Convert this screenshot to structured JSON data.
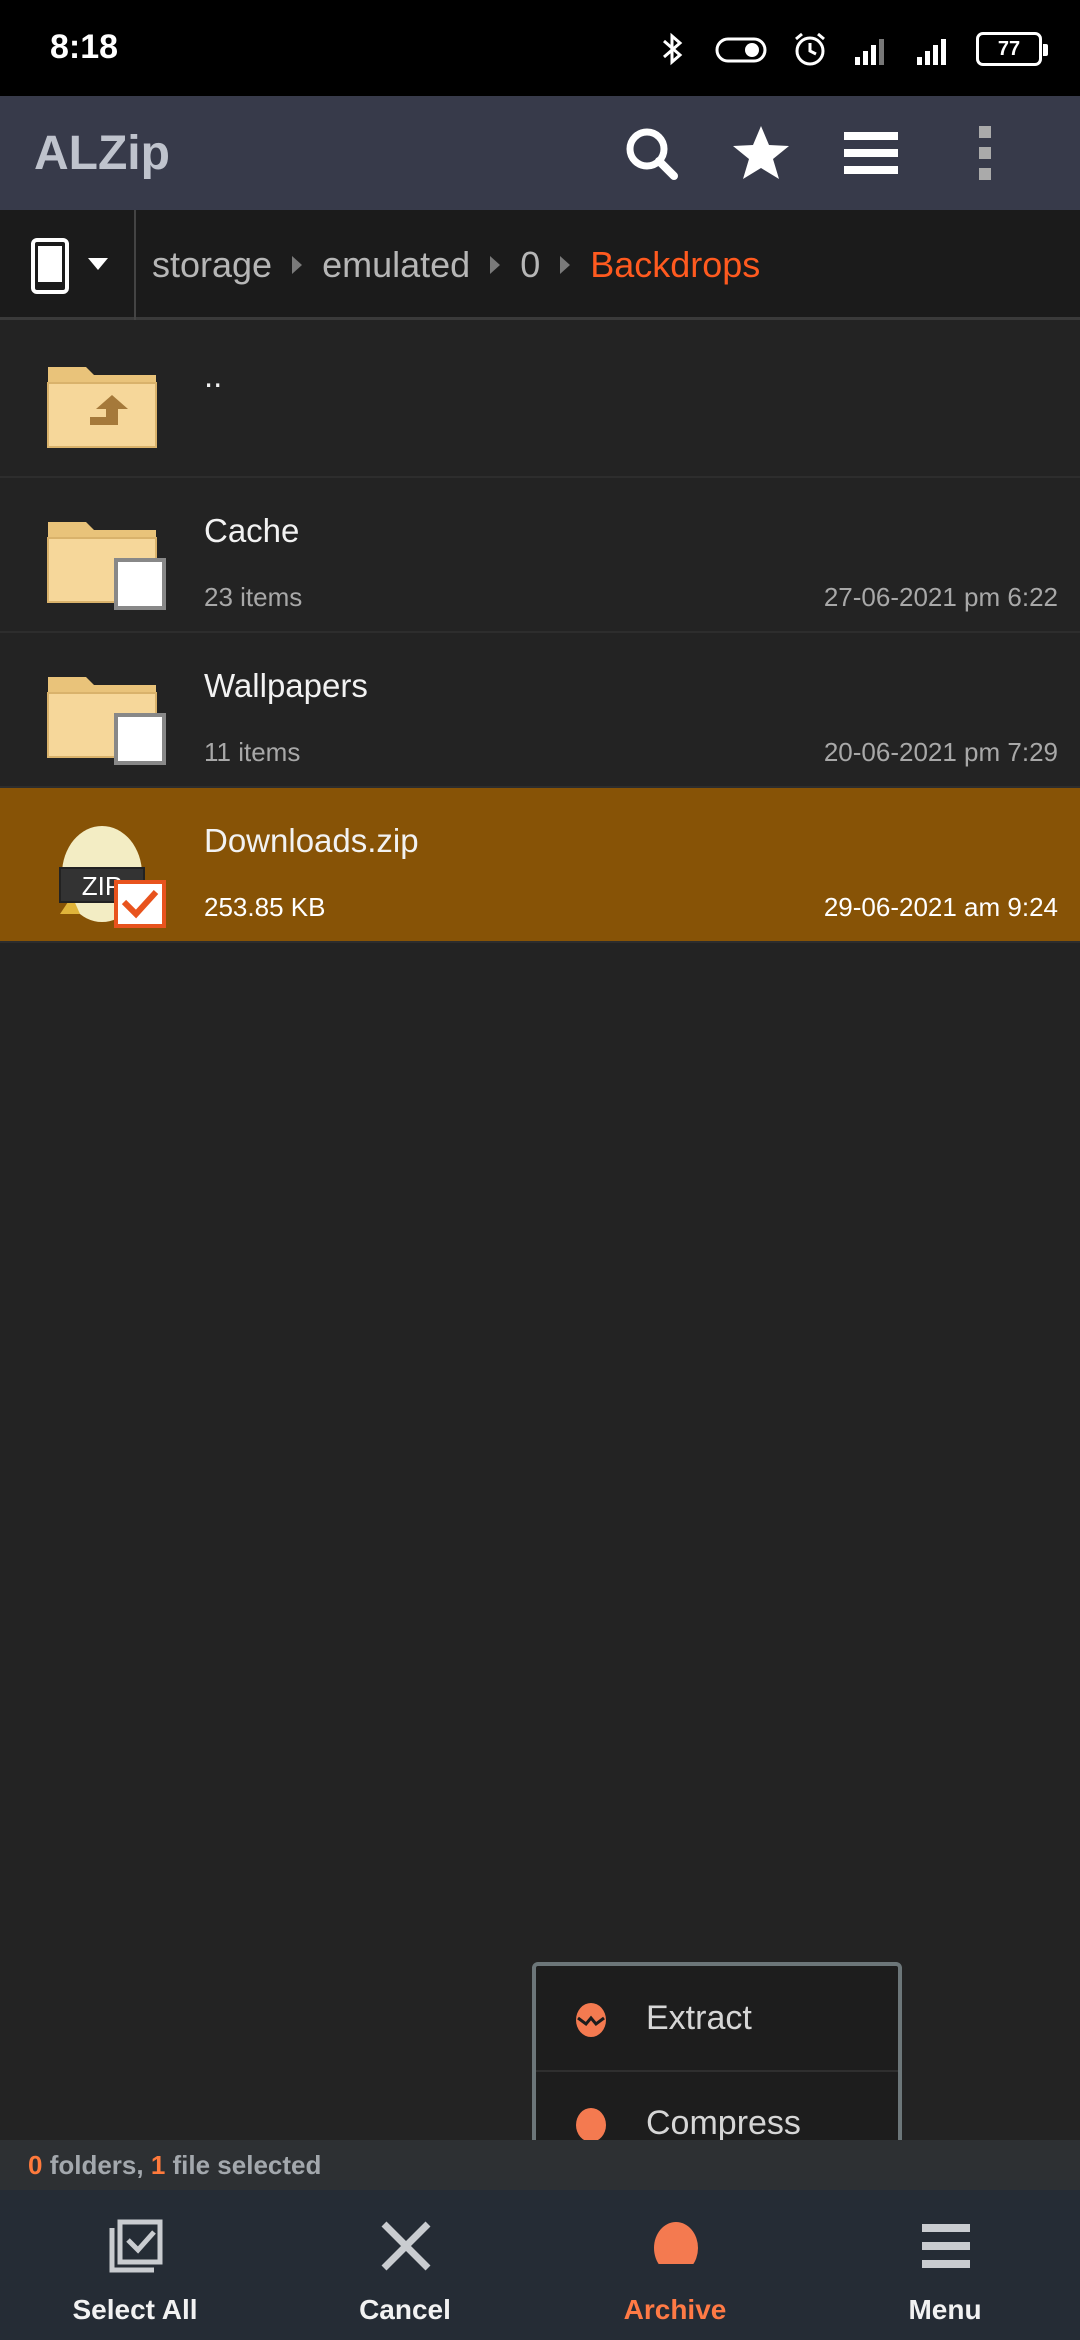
{
  "status_bar": {
    "time": "8:18",
    "battery": "77",
    "icons": [
      "bluetooth-icon",
      "toggle-icon",
      "alarm-icon",
      "signal-icon",
      "signal-icon",
      "battery-icon"
    ]
  },
  "app_bar": {
    "title": "ALZip",
    "actions": [
      "search-icon",
      "star-icon",
      "list-icon",
      "more-vert-icon"
    ]
  },
  "breadcrumb": {
    "device_icon": "phone-icon",
    "items": [
      "storage",
      "emulated",
      "0",
      "Backdrops"
    ]
  },
  "files": [
    {
      "name": "..",
      "meta": "",
      "date": "",
      "type": "parent-folder"
    },
    {
      "name": "Cache",
      "meta": "23 items",
      "date": "27-06-2021 pm 6:22",
      "type": "folder",
      "checked": false
    },
    {
      "name": "Wallpapers",
      "meta": "11 items",
      "date": "20-06-2021 pm 7:29",
      "type": "folder",
      "checked": false
    },
    {
      "name": "Downloads.zip",
      "meta": "253.85 KB",
      "date": "29-06-2021 am 9:24",
      "type": "zip",
      "checked": true,
      "badge": "ZIP"
    }
  ],
  "popup_menu": {
    "items": [
      {
        "label": "Extract",
        "icon": "extract-icon"
      },
      {
        "label": "Compress",
        "icon": "compress-icon"
      }
    ]
  },
  "selection_status": {
    "folders": "0",
    "folders_text": " folders, ",
    "files": "1",
    "files_text": " file selected"
  },
  "bottom_nav": [
    {
      "label": "Select All",
      "icon": "select-all-icon"
    },
    {
      "label": "Cancel",
      "icon": "close-icon"
    },
    {
      "label": "Archive",
      "icon": "archive-icon",
      "active": true
    },
    {
      "label": "Menu",
      "icon": "menu-icon"
    }
  ],
  "colors": {
    "accent": "#ff5a1f",
    "selected_row": "#875306",
    "app_bar": "#373a4a",
    "bottom_nav": "#252c35"
  }
}
